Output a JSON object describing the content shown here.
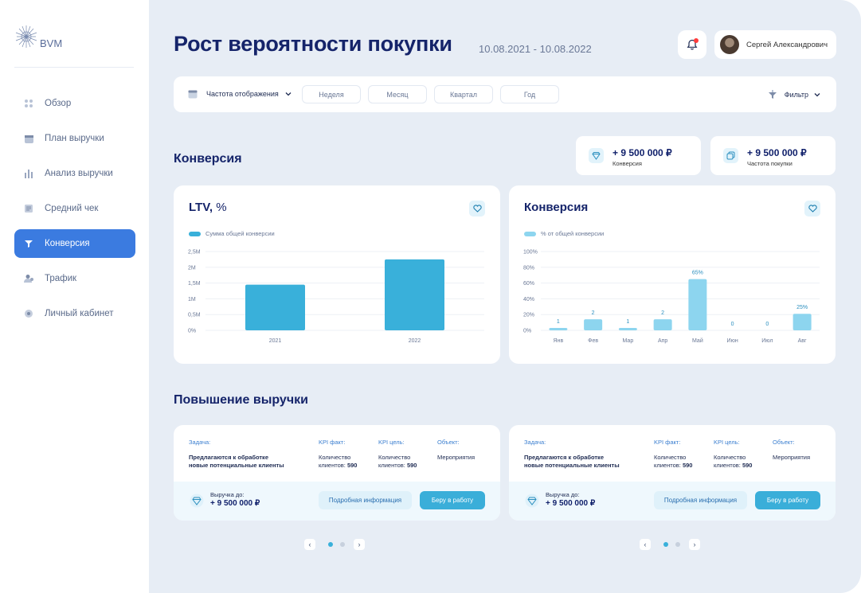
{
  "logo": {
    "text": "BVM"
  },
  "sidebar": {
    "items": [
      {
        "label": "Обзор",
        "icon": "dots-grid-icon",
        "active": false
      },
      {
        "label": "План выручки",
        "icon": "calendar-icon",
        "active": false
      },
      {
        "label": "Анализ выручки",
        "icon": "bar-chart-icon",
        "active": false
      },
      {
        "label": "Средний чек",
        "icon": "receipt-icon",
        "active": false
      },
      {
        "label": "Конверсия",
        "icon": "funnel-icon",
        "active": true
      },
      {
        "label": "Трафик",
        "icon": "users-icon",
        "active": false
      },
      {
        "label": "Личный кабинет",
        "icon": "gear-icon",
        "active": false
      }
    ]
  },
  "header": {
    "title": "Рост вероятности покупки",
    "date_range": "10.08.2021 - 10.08.2022",
    "user_name": "Сергей Александрович"
  },
  "filterbar": {
    "frequency_label": "Частота отображения",
    "periods": [
      "Неделя",
      "Месяц",
      "Квартал",
      "Год"
    ],
    "filter_label": "Фильтр"
  },
  "conversion_section": {
    "title": "Конверсия"
  },
  "stats": [
    {
      "value": "+ 9 500 000 ₽",
      "label": "Конверсия",
      "icon": "diamond-icon"
    },
    {
      "value": "+ 9 500 000 ₽",
      "label": "Частота покупки",
      "icon": "copy-icon"
    }
  ],
  "colors": {
    "accent": "#3b7be0",
    "bar_dark": "#39b0da",
    "bar_light": "#8dd5ef",
    "title": "#15246a"
  },
  "chart_data": [
    {
      "type": "bar",
      "title": "LTV,",
      "title_unit": "%",
      "legend": "Сумма общей конверсии",
      "categories": [
        "2021",
        "2022"
      ],
      "values": [
        1.45,
        2.25
      ],
      "y_ticks": [
        "2,5M",
        "2M",
        "1,5M",
        "1M",
        "0,5M",
        "0%"
      ],
      "ylim": [
        0,
        2.5
      ],
      "grid": true
    },
    {
      "type": "bar",
      "title": "Конверсия",
      "legend": "% от общей конверсии",
      "categories": [
        "Янв",
        "Фев",
        "Мар",
        "Апр",
        "Май",
        "Июн",
        "Июл",
        "Авг"
      ],
      "values": [
        3,
        14,
        3,
        14,
        65,
        0,
        0,
        21
      ],
      "data_labels": [
        "1",
        "2",
        "1",
        "2",
        "65%",
        "0",
        "0",
        "25%"
      ],
      "y_ticks": [
        "100%",
        "80%",
        "60%",
        "40%",
        "20%",
        "0%"
      ],
      "ylim": [
        0,
        100
      ],
      "grid": true
    }
  ],
  "revenue_section": {
    "title": "Повышение выручки"
  },
  "revenue_cards": [
    {
      "task_label": "Задача:",
      "task_line1": "Предлагаются к обработке",
      "task_line2": "новые потенциальные клиенты",
      "kpi_fact_label": "KPI факт:",
      "kpi_fact_line1": "Количество",
      "kpi_fact_prefix": "клиентов:",
      "kpi_fact_value": "590",
      "kpi_goal_label": "KPI цель:",
      "kpi_goal_line1": "Количество",
      "kpi_goal_prefix": "клиентов:",
      "kpi_goal_value": "590",
      "object_label": "Объект:",
      "object_value": "Мероприятия",
      "revenue_label": "Выручка до:",
      "revenue_value": "+ 9 500 000 ₽",
      "more_button": "Подробная информация",
      "take_button": "Беру в работу"
    },
    {
      "task_label": "Задача:",
      "task_line1": "Предлагаются к обработке",
      "task_line2": "новые потенциальные клиенты",
      "kpi_fact_label": "KPI факт:",
      "kpi_fact_line1": "Количество",
      "kpi_fact_prefix": "клиентов:",
      "kpi_fact_value": "590",
      "kpi_goal_label": "KPI цель:",
      "kpi_goal_line1": "Количество",
      "kpi_goal_prefix": "клиентов:",
      "kpi_goal_value": "590",
      "object_label": "Объект:",
      "object_value": "Мероприятия",
      "revenue_label": "Выручка до:",
      "revenue_value": "+ 9 500 000 ₽",
      "more_button": "Подробная информация",
      "take_button": "Беру в работу"
    }
  ],
  "pager": {
    "prev": "‹",
    "next": "›",
    "pages": 2,
    "current": 1
  }
}
